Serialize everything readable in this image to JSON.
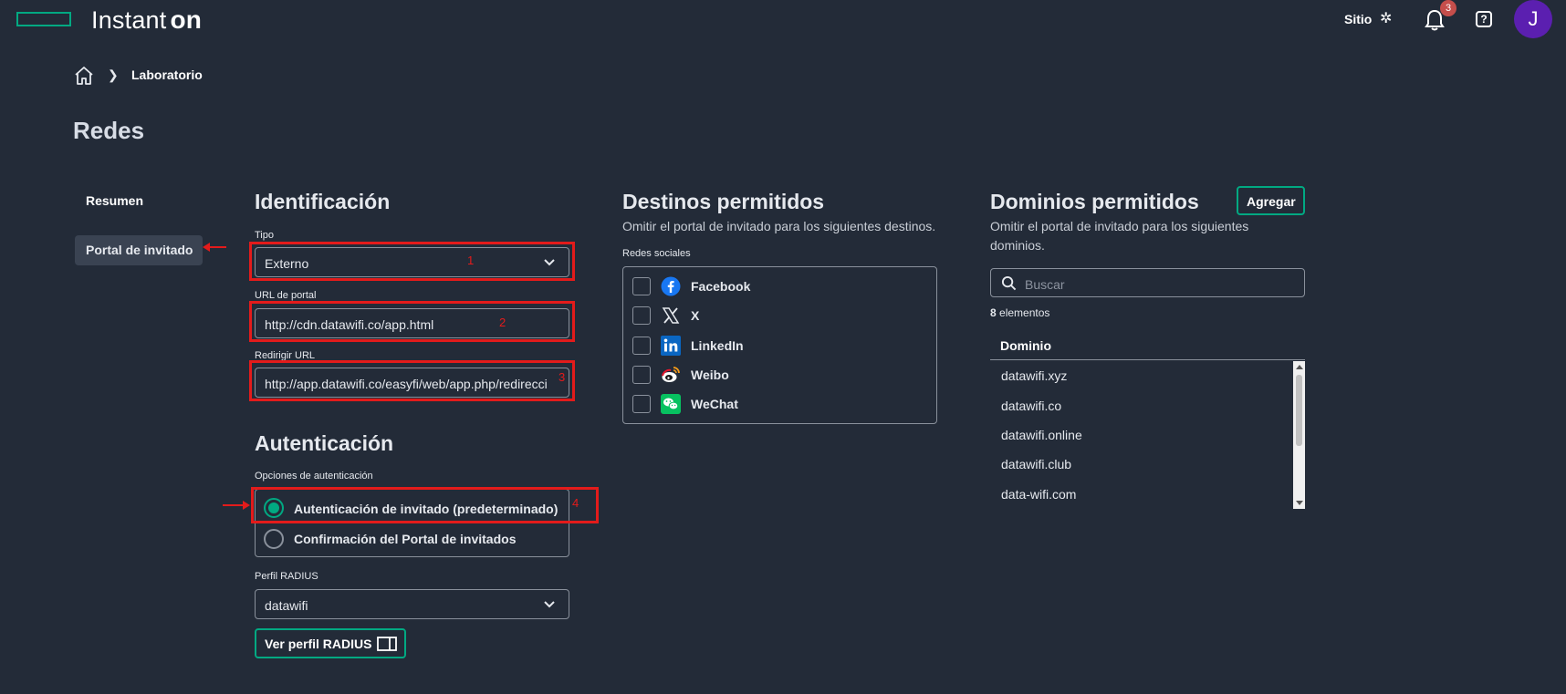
{
  "header": {
    "brand": "Instant",
    "brand_on": "on",
    "site_label": "Sitio",
    "notification_count": "3",
    "help": "?",
    "avatar_initial": "J"
  },
  "breadcrumb": {
    "current": "Laboratorio"
  },
  "page_title": "Redes",
  "sidebar": {
    "items": [
      {
        "label": "Resumen"
      },
      {
        "label": "Portal de invitado"
      }
    ]
  },
  "identificacion": {
    "title": "Identificación",
    "tipo_label": "Tipo",
    "tipo_value": "Externo",
    "url_label": "URL de portal",
    "url_value": "http://cdn.datawifi.co/app.html",
    "redirect_label": "Redirigir URL",
    "redirect_value": "http://app.datawifi.co/easyfi/web/app.php/redirecci"
  },
  "autenticacion": {
    "title": "Autenticación",
    "options_label": "Opciones de autenticación",
    "options": [
      {
        "label": "Autenticación de invitado (predeterminado)",
        "selected": true
      },
      {
        "label": "Confirmación del Portal de invitados",
        "selected": false
      }
    ],
    "radius_label": "Perfil RADIUS",
    "radius_value": "datawifi",
    "view_radius_button": "Ver perfil RADIUS"
  },
  "annotations": [
    "1",
    "2",
    "3",
    "4"
  ],
  "destinos": {
    "title": "Destinos permitidos",
    "description": "Omitir el portal de invitado para los siguientes destinos.",
    "social_label": "Redes sociales",
    "social": [
      {
        "label": "Facebook",
        "icon": "facebook-icon"
      },
      {
        "label": "X",
        "icon": "x-icon"
      },
      {
        "label": "LinkedIn",
        "icon": "linkedin-icon"
      },
      {
        "label": "Weibo",
        "icon": "weibo-icon"
      },
      {
        "label": "WeChat",
        "icon": "wechat-icon"
      }
    ]
  },
  "dominios": {
    "title": "Dominios permitidos",
    "add_button": "Agregar",
    "description_line1": "Omitir el portal de invitado para los siguientes",
    "description_line2": "dominios.",
    "search_placeholder": "Buscar",
    "count_number": "8",
    "count_label": "elementos",
    "column_header": "Dominio",
    "rows": [
      "datawifi.xyz",
      "datawifi.co",
      "datawifi.online",
      "datawifi.club",
      "data-wifi.com"
    ]
  },
  "colors": {
    "background": "#232b38",
    "accent": "#01a982",
    "annotation": "#e31b1b",
    "avatar": "#5b1fb0"
  }
}
